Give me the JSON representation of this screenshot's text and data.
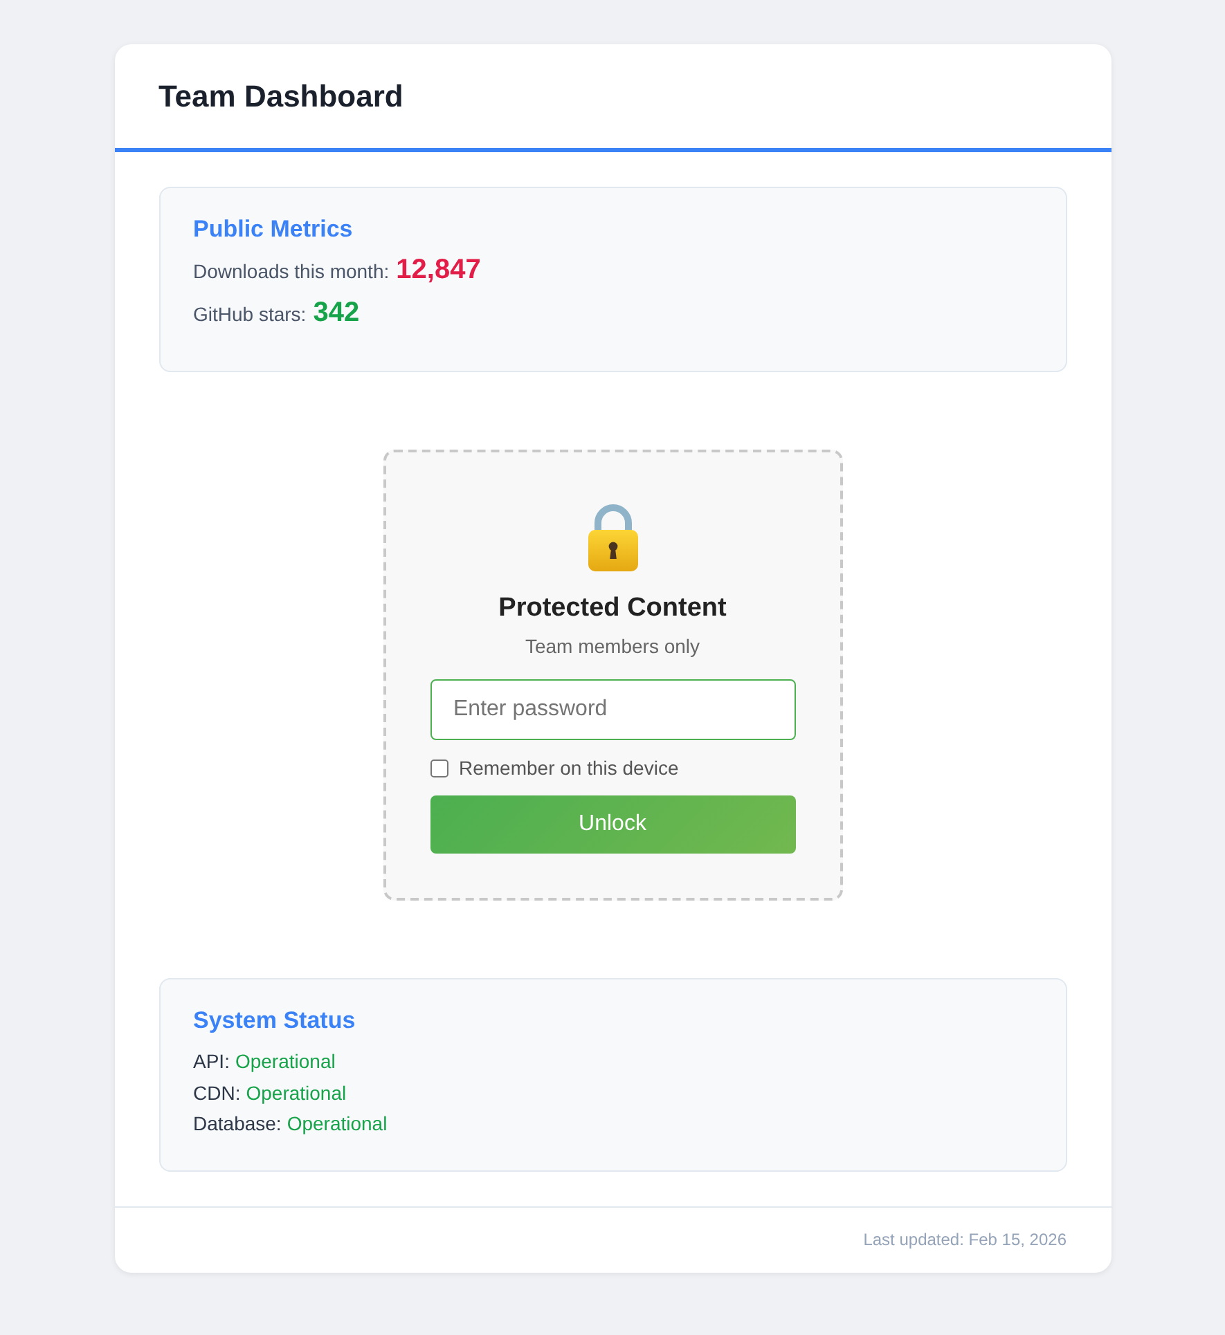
{
  "header": {
    "title": "Team Dashboard"
  },
  "public_metrics": {
    "title": "Public Metrics",
    "metrics": [
      {
        "label": "Downloads this month:",
        "value": "12,847",
        "color": "#e11d48"
      },
      {
        "label": "GitHub stars:",
        "value": "342",
        "color": "#16a34a"
      }
    ]
  },
  "protected": {
    "title": "Protected Content",
    "subtitle": "Team members only",
    "password": {
      "placeholder": "Enter password"
    },
    "remember": {
      "label": "Remember on this device",
      "checked": false
    },
    "button": "Unlock"
  },
  "system_status": {
    "title": "System Status",
    "services": [
      {
        "name": "API:",
        "status": "Operational"
      },
      {
        "name": "CDN:",
        "status": "Operational"
      },
      {
        "name": "Database:",
        "status": "Operational"
      }
    ]
  },
  "footer": {
    "text": "Last updated: Feb 15, 2026"
  }
}
